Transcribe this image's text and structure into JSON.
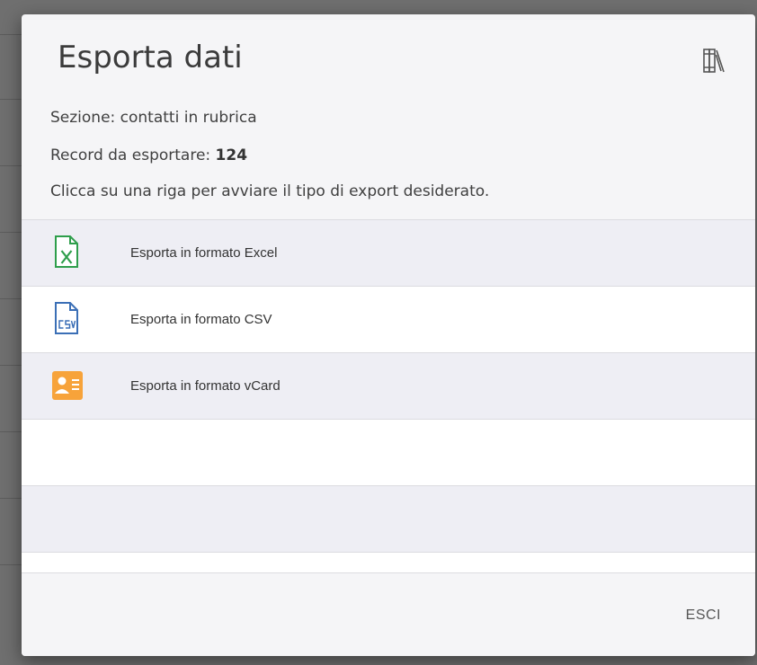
{
  "dialog": {
    "title": "Esporta dati",
    "title_icon": "books-icon",
    "section_label": "Sezione: contatti in rubrica",
    "records_label": "Record da esportare:",
    "records_count": "124",
    "instruction": "Clicca su una riga per avviare il tipo di export desiderato."
  },
  "export_options": [
    {
      "label": "Esporta in formato Excel",
      "icon": "excel-file-icon",
      "color": "#2e9e4b"
    },
    {
      "label": "Esporta in formato CSV",
      "icon": "csv-file-icon",
      "color": "#3b6fb6"
    },
    {
      "label": "Esporta in formato vCard",
      "icon": "vcard-icon",
      "color": "#f7a33a"
    }
  ],
  "footer": {
    "exit_label": "ESCI"
  }
}
